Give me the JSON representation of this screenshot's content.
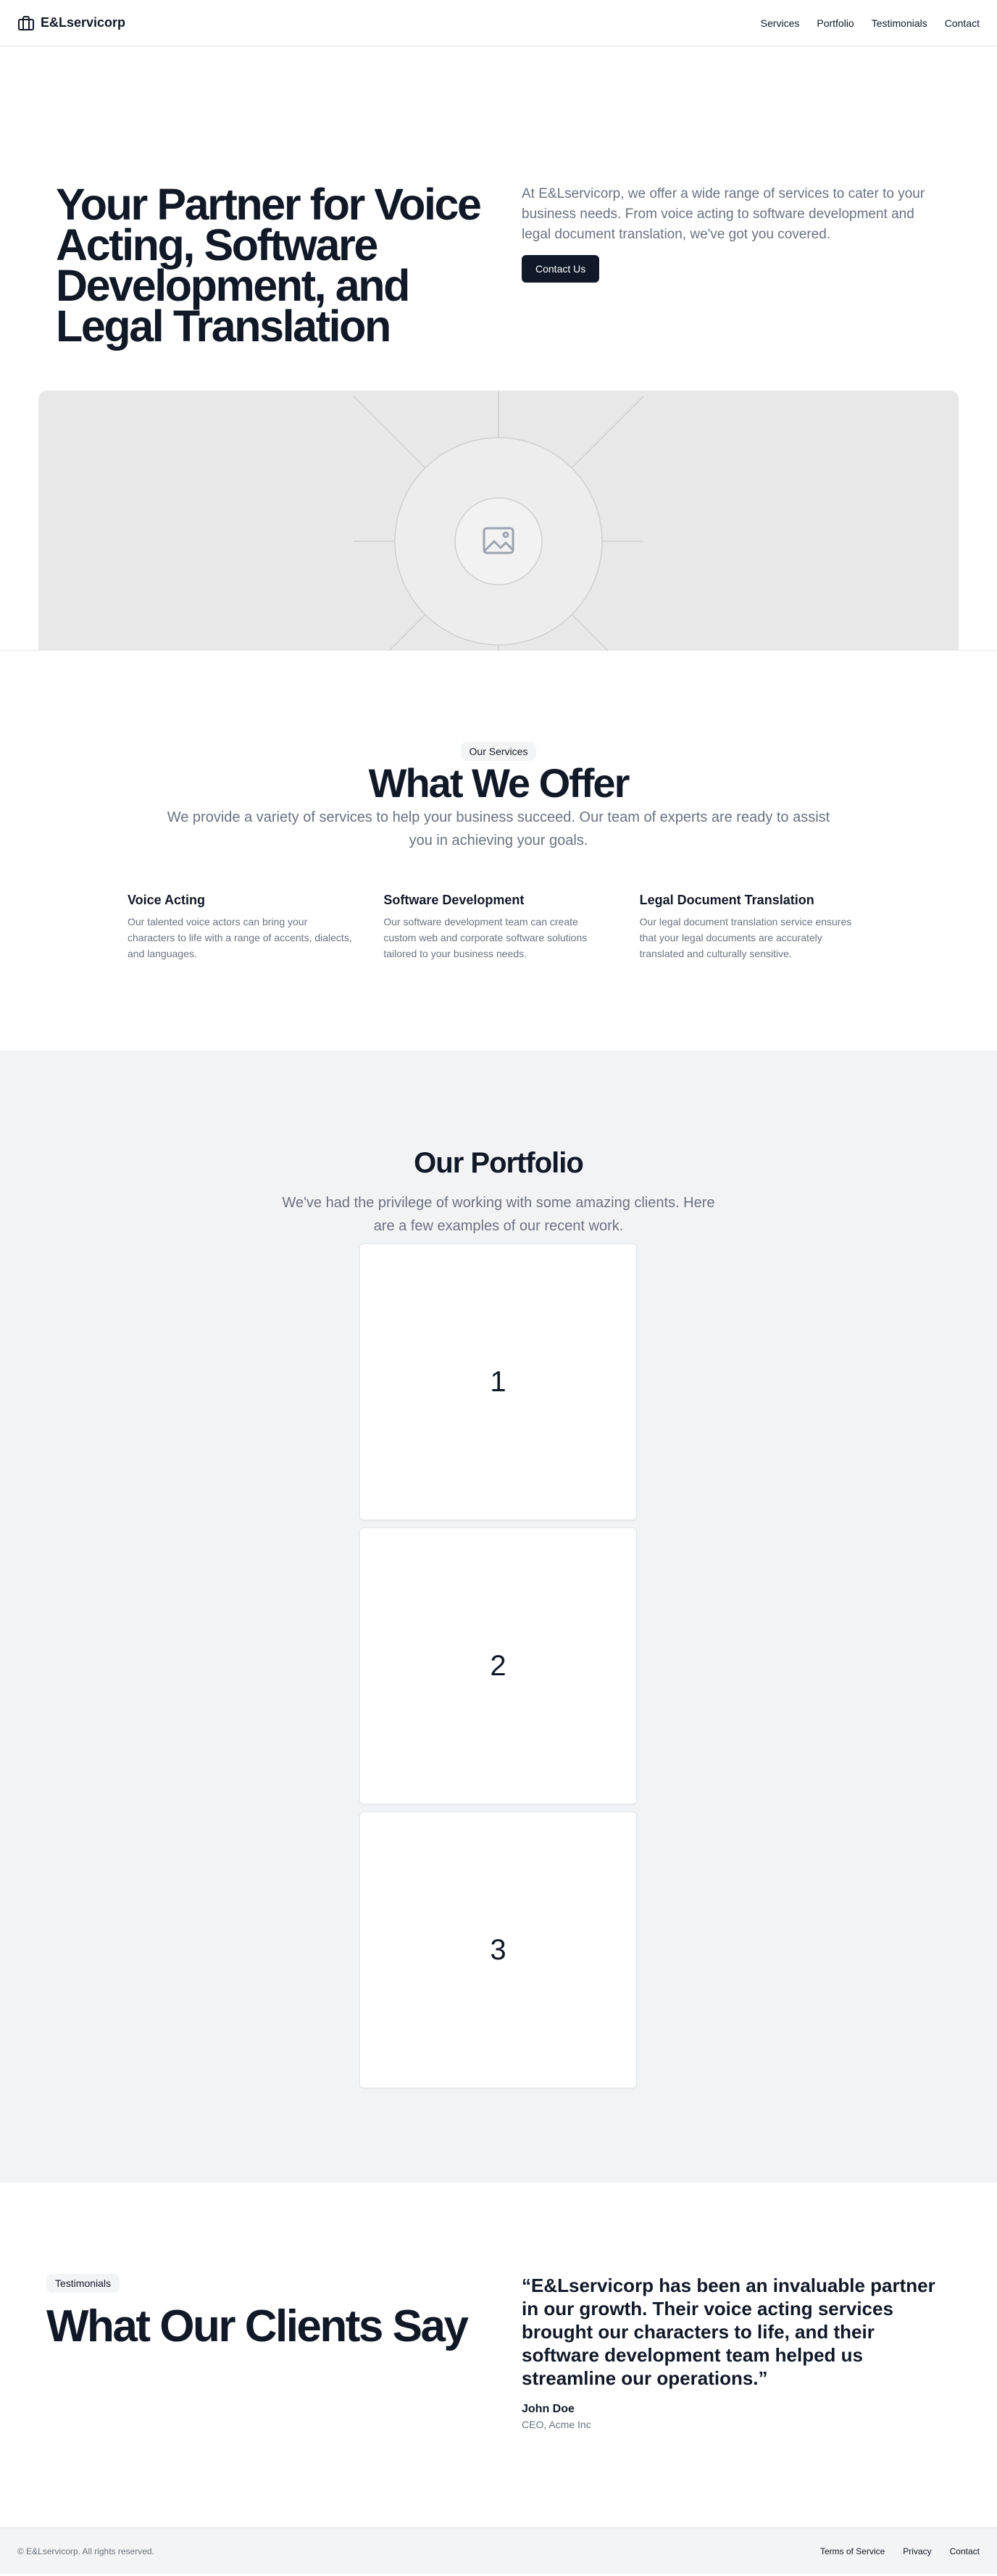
{
  "header": {
    "brand_name": "E&Lservicorp",
    "brand_icon": "briefcase-icon",
    "nav": [
      "Services",
      "Portfolio",
      "Testimonials",
      "Contact"
    ]
  },
  "hero": {
    "headline": "Your Partner for Voice Acting, Software Development, and Legal Translation",
    "description": "At E&Lservicorp, we offer a wide range of services to cater to your business needs. From voice acting to software development and legal document translation, we've got you covered.",
    "cta_label": "Contact Us",
    "image_icon": "image-placeholder-icon"
  },
  "services": {
    "badge": "Our Services",
    "title": "What We Offer",
    "subtitle": "We provide a variety of services to help your business succeed. Our team of experts are ready to assist you in achieving your goals.",
    "items": [
      {
        "title": "Voice Acting",
        "description": "Our talented voice actors can bring your characters to life with a range of accents, dialects, and languages."
      },
      {
        "title": "Software Development",
        "description": "Our software development team can create custom web and corporate software solutions tailored to your business needs."
      },
      {
        "title": "Legal Document Translation",
        "description": "Our legal document translation service ensures that your legal documents are accurately translated and culturally sensitive."
      }
    ]
  },
  "portfolio": {
    "title": "Our Portfolio",
    "subtitle": "We've had the privilege of working with some amazing clients. Here are a few examples of our recent work.",
    "cards": [
      "1",
      "2",
      "3"
    ]
  },
  "testimonials": {
    "badge": "Testimonials",
    "title": "What Our Clients Say",
    "quote": "“E&Lservicorp has been an invaluable partner in our growth. Their voice acting services brought our characters to life, and their software development team helped us streamline our operations.”",
    "author": "John Doe",
    "role": "CEO, Acme Inc"
  },
  "footer": {
    "copyright": "© E&Lservicorp. All rights reserved.",
    "links": [
      "Terms of Service",
      "Privacy",
      "Contact"
    ]
  }
}
